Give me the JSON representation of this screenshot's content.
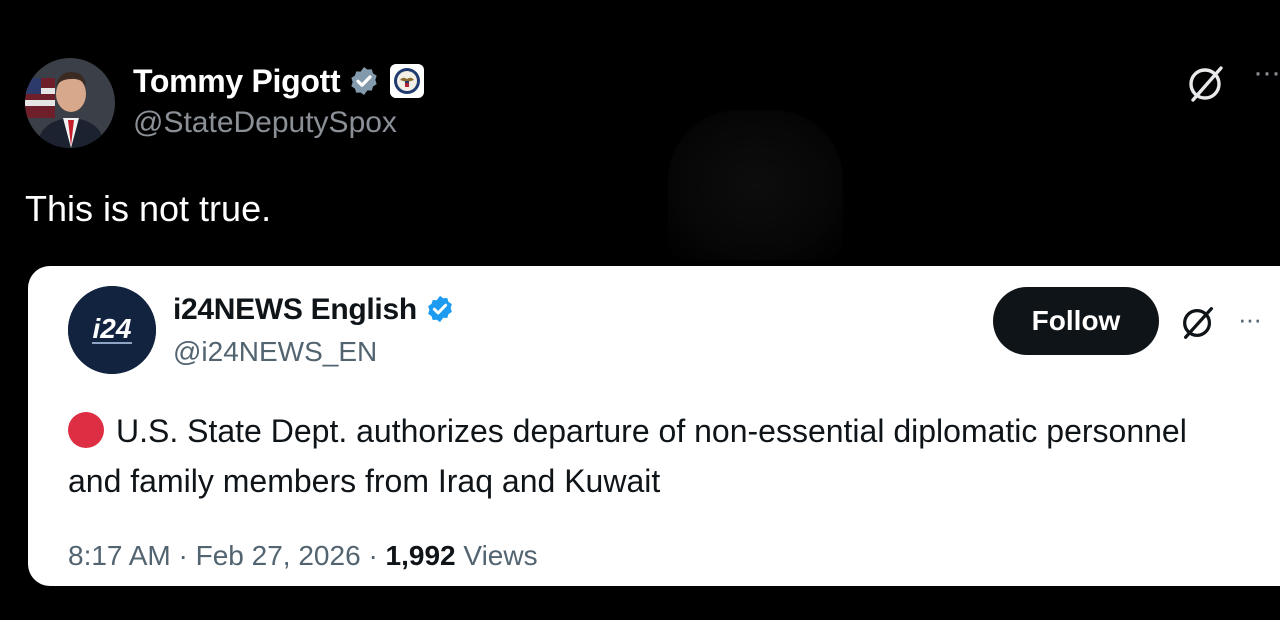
{
  "post": {
    "author_name": "Tommy Pigott",
    "author_handle": "@StateDeputySpox",
    "text": "This is not true.",
    "more_label": "···"
  },
  "quoted_post": {
    "author_name": "i24NEWS English",
    "author_handle": "@i24NEWS_EN",
    "avatar_logo_text": "i24",
    "follow_label": "Follow",
    "more_label": "···",
    "text": "U.S. State Dept. authorizes departure of non-essential diplomatic personnel and family members from Iraq and Kuwait",
    "time": "8:17 AM",
    "separator": "·",
    "date": "Feb 27, 2026",
    "views_count": "1,992",
    "views_label": "Views"
  },
  "icons": {
    "verified": "verified-badge-icon",
    "affiliate_seal": "state-department-seal-icon",
    "grok": "grok-icon",
    "more": "more-options-icon",
    "red_circle": "red-circle-emoji-icon"
  },
  "colors": {
    "background": "#000000",
    "verified_outer": "#829aab",
    "verified_inner": "#1d9bf0",
    "follow_button": "#0f1419",
    "red_circle": "#dd2e44",
    "secondary_text": "#536471"
  }
}
